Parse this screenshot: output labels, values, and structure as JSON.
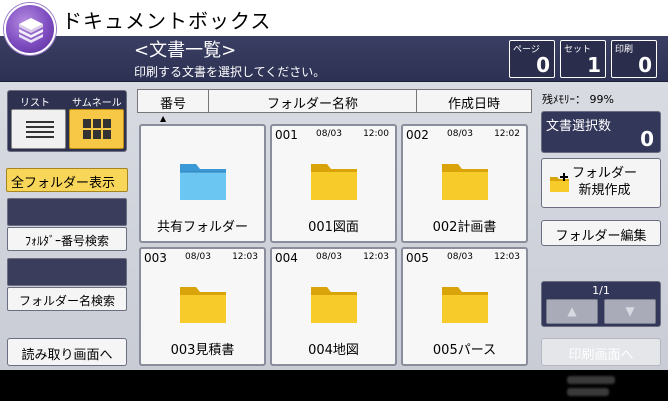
{
  "app": {
    "title": "ドキュメントボックス",
    "icon": "document-box-icon"
  },
  "header": {
    "title": "<文書一覧>",
    "subtitle": "印刷する文書を選択してください。",
    "counters": [
      {
        "label": "ページ",
        "value": "0"
      },
      {
        "label": "セット",
        "value": "1"
      },
      {
        "label": "印刷",
        "value": "0"
      }
    ]
  },
  "view": {
    "list_label": "リスト",
    "thumb_label": "サムネール",
    "selected": "thumbnail"
  },
  "left": {
    "all_folders": "全フォルダー表示",
    "number_search": "ﾌｫﾙﾀﾞｰ番号検索",
    "name_search": "フォルダー名検索",
    "read_screen": "読み取り画面へ"
  },
  "columns": {
    "number": "番号",
    "folder_name": "フォルダー名称",
    "created": "作成日時"
  },
  "folders": [
    {
      "num": "",
      "date": "",
      "time": "",
      "name": "共有フォルダー",
      "color": "#5ab8ea"
    },
    {
      "num": "001",
      "date": "08/03",
      "time": "12:00",
      "name": "001図面",
      "color": "#f5c417"
    },
    {
      "num": "002",
      "date": "08/03",
      "time": "12:02",
      "name": "002計画書",
      "color": "#f5c417"
    },
    {
      "num": "003",
      "date": "08/03",
      "time": "12:03",
      "name": "003見積書",
      "color": "#f5c417"
    },
    {
      "num": "004",
      "date": "08/03",
      "time": "12:03",
      "name": "004地図",
      "color": "#f5c417"
    },
    {
      "num": "005",
      "date": "08/03",
      "time": "12:03",
      "name": "005パース",
      "color": "#f5c417"
    }
  ],
  "right": {
    "memory": "残ﾒﾓﾘｰ： 99%",
    "selected_label": "文書選択数",
    "selected_count": "0",
    "new_folder_line1": "フォルダー",
    "new_folder_line2": "新規作成",
    "edit_folder": "フォルダー編集",
    "page": "1/1",
    "up_arrow": "▲",
    "down_arrow": "▼",
    "to_print": "印刷画面へ"
  }
}
